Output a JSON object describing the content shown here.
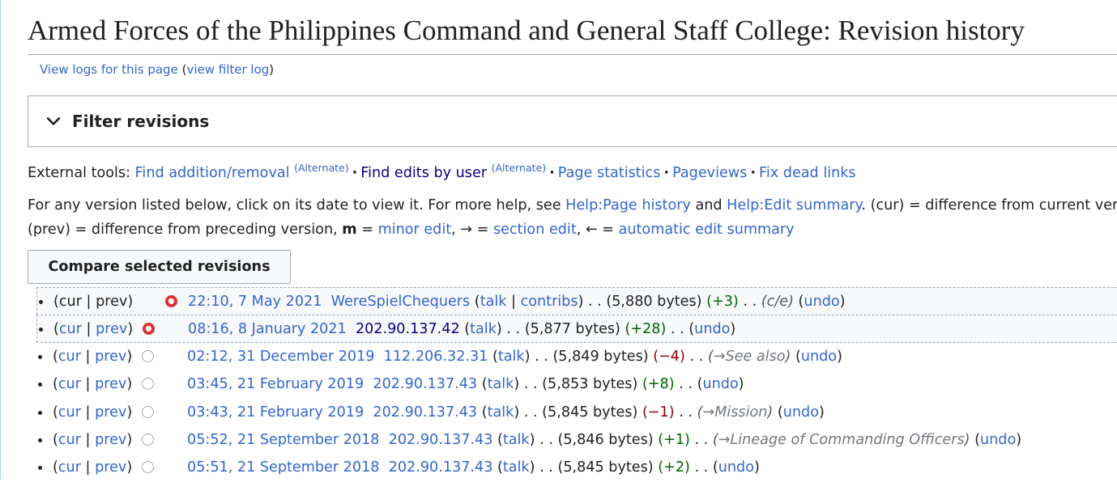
{
  "page": {
    "title": "Armed Forces of the Philippines Command and General Staff College: Revision history",
    "view_logs": "View logs for this page",
    "view_filter_log": "view filter log"
  },
  "filter": {
    "label": "Filter revisions"
  },
  "external_tools": {
    "prefix": "External tools:",
    "find_addition": "Find addition/removal",
    "alt1": "(Alternate)",
    "find_edits": "Find edits by user",
    "alt2": "(Alternate)",
    "page_statistics": "Page statistics",
    "pageviews": "Pageviews",
    "fix_dead_links": "Fix dead links"
  },
  "help": {
    "line1_a": "For any version listed below, click on its date to view it. For more help, see ",
    "help_page_history": "Help:Page history",
    "line1_and": " and ",
    "help_edit_summary": "Help:Edit summary",
    "line1_b": ". (cur) = difference from current version,",
    "line2_a": "(prev) = difference from preceding version,  ",
    "minor_m": "m",
    "line2_eq1": " = ",
    "minor_edit": "minor edit",
    "line2_arrow": ", → = ",
    "section_edit": "section edit",
    "line2_back": ", ← = ",
    "auto_summary": "automatic edit summary"
  },
  "compare_button": "Compare selected revisions",
  "labels": {
    "cur": "cur",
    "prev": "prev",
    "talk": "talk",
    "contribs": "contribs",
    "undo": "undo"
  },
  "revisions": [
    {
      "date": "22:10, 7 May 2021",
      "user": "WereSpielChequers",
      "bytes": "(5,880 bytes)",
      "diff": "(+3)",
      "summary": "c/e"
    },
    {
      "date": "08:16, 8 January 2021",
      "user": "202.90.137.42",
      "bytes": "(5,877 bytes)",
      "diff": "(+28)",
      "summary": ""
    },
    {
      "date": "02:12, 31 December 2019",
      "user": "112.206.32.31",
      "bytes": "(5,849 bytes)",
      "diff": "(−4)",
      "summary": "→See also"
    },
    {
      "date": "03:45, 21 February 2019",
      "user": "202.90.137.43",
      "bytes": "(5,853 bytes)",
      "diff": "(+8)",
      "summary": ""
    },
    {
      "date": "03:43, 21 February 2019",
      "user": "202.90.137.43",
      "bytes": "(5,845 bytes)",
      "diff": "(−1)",
      "summary": "→Mission"
    },
    {
      "date": "05:52, 21 September 2018",
      "user": "202.90.137.43",
      "bytes": "(5,846 bytes)",
      "diff": "(+1)",
      "summary": "→Lineage of Commanding Officers"
    },
    {
      "date": "05:51, 21 September 2018",
      "user": "202.90.137.43",
      "bytes": "(5,845 bytes)",
      "diff": "(+2)",
      "summary": ""
    }
  ]
}
